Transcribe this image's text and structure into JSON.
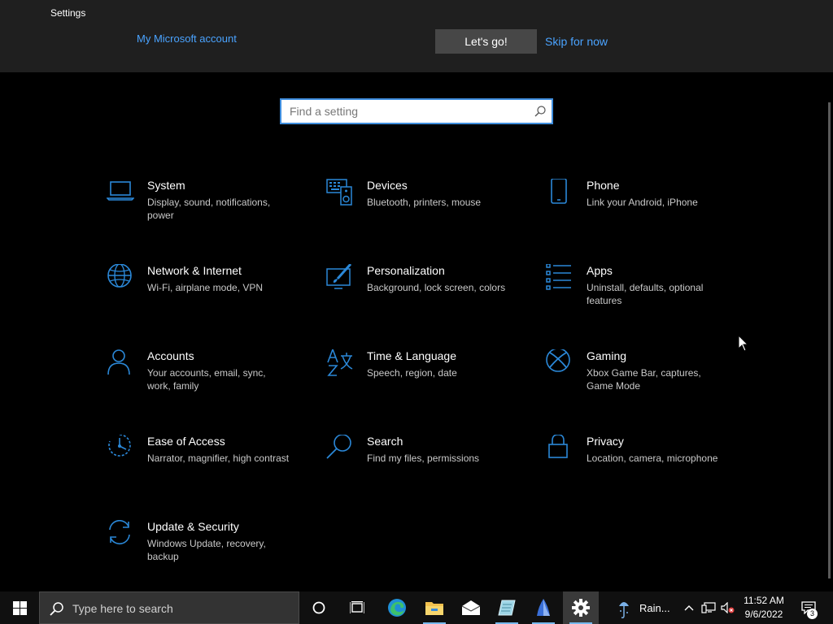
{
  "window": {
    "title": "Settings"
  },
  "banner": {
    "account_link": "My Microsoft account",
    "lets_go": "Let's go!",
    "skip": "Skip for now"
  },
  "search": {
    "placeholder": "Find a setting"
  },
  "tiles": [
    {
      "name": "System",
      "desc": "Display, sound, notifications, power",
      "icon": "laptop-icon"
    },
    {
      "name": "Devices",
      "desc": "Bluetooth, printers, mouse",
      "icon": "keyboard-speaker-icon"
    },
    {
      "name": "Phone",
      "desc": "Link your Android, iPhone",
      "icon": "phone-icon"
    },
    {
      "name": "Network & Internet",
      "desc": "Wi-Fi, airplane mode, VPN",
      "icon": "globe-icon"
    },
    {
      "name": "Personalization",
      "desc": "Background, lock screen, colors",
      "icon": "paint-monitor-icon"
    },
    {
      "name": "Apps",
      "desc": "Uninstall, defaults, optional features",
      "icon": "app-list-icon"
    },
    {
      "name": "Accounts",
      "desc": "Your accounts, email, sync, work, family",
      "icon": "person-icon"
    },
    {
      "name": "Time & Language",
      "desc": "Speech, region, date",
      "icon": "time-language-icon"
    },
    {
      "name": "Gaming",
      "desc": "Xbox Game Bar, captures, Game Mode",
      "icon": "xbox-icon"
    },
    {
      "name": "Ease of Access",
      "desc": "Narrator, magnifier, high contrast",
      "icon": "ease-of-access-icon"
    },
    {
      "name": "Search",
      "desc": "Find my files, permissions",
      "icon": "magnifier-icon"
    },
    {
      "name": "Privacy",
      "desc": "Location, camera, microphone",
      "icon": "lock-icon"
    },
    {
      "name": "Update & Security",
      "desc": "Windows Update, recovery, backup",
      "icon": "sync-arrows-icon"
    }
  ],
  "taskbar": {
    "search_placeholder": "Type here to search",
    "weather_label": "Rain...",
    "time": "11:52 AM",
    "date": "9/6/2022",
    "notification_count": "3"
  },
  "colors": {
    "accent": "#2b88d8",
    "link": "#4aa3ff",
    "banner_bg": "#1f1f1f",
    "button_bg": "#474747",
    "taskbar_bg": "#101010"
  }
}
